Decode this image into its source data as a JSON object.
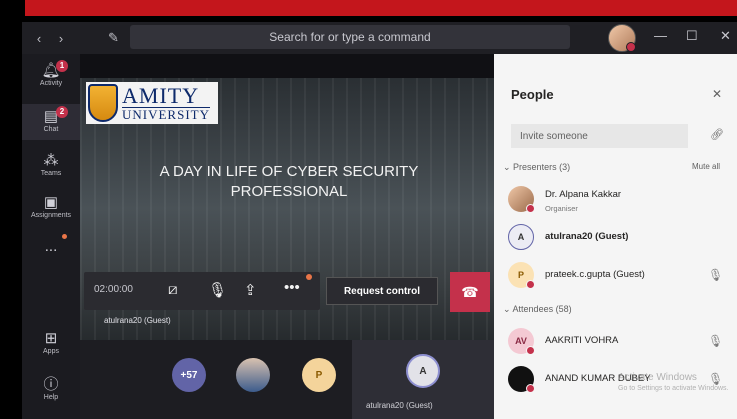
{
  "topbar": {
    "back": "‹",
    "forward": "›",
    "search_placeholder": "Search for or type a command",
    "minimize": "—",
    "maximize": "☐",
    "close": "✕"
  },
  "rail": {
    "items": [
      {
        "label": "Activity",
        "badge": "1"
      },
      {
        "label": "Chat",
        "badge": "2"
      },
      {
        "label": "Teams"
      },
      {
        "label": "Assignments"
      },
      {
        "label": "..."
      },
      {
        "label": "Apps"
      },
      {
        "label": "Help"
      }
    ]
  },
  "meeting": {
    "logo_big": "AMITY",
    "logo_small": "UNIVERSITY",
    "headline": "A DAY IN LIFE OF CYBER SECURITY PROFESSIONAL",
    "duration": "02:00:00",
    "request_control": "Request control",
    "presenter_name": "atulrana20 (Guest)",
    "gallery": {
      "overflow_count": "+57",
      "p_initial": "P",
      "a_initial": "A",
      "tile_name": "atulrana20 (Guest)"
    }
  },
  "people": {
    "title": "People",
    "invite_placeholder": "Invite someone",
    "presenters_label": "Presenters (3)",
    "mute_all": "Mute all",
    "presenters": [
      {
        "name": "Dr. Alpana Kakkar",
        "role": "Organiser"
      },
      {
        "name": "atulrana20 (Guest)",
        "initial": "A"
      },
      {
        "name": "prateek.c.gupta (Guest)",
        "initial": "P"
      }
    ],
    "attendees_label": "Attendees (58)",
    "attendees": [
      {
        "name": "AAKRITI VOHRA",
        "initial": "AV"
      },
      {
        "name": "ANAND KUMAR DUBEY"
      }
    ],
    "watermark_line1": "Activate Windows",
    "watermark_line2": "Go to Settings to activate Windows."
  },
  "colors": {
    "accent_red": "#c4314b",
    "brand_red": "#c4161c",
    "dark_bg": "#1f1f24",
    "panel_bg": "#f5f5f5"
  }
}
